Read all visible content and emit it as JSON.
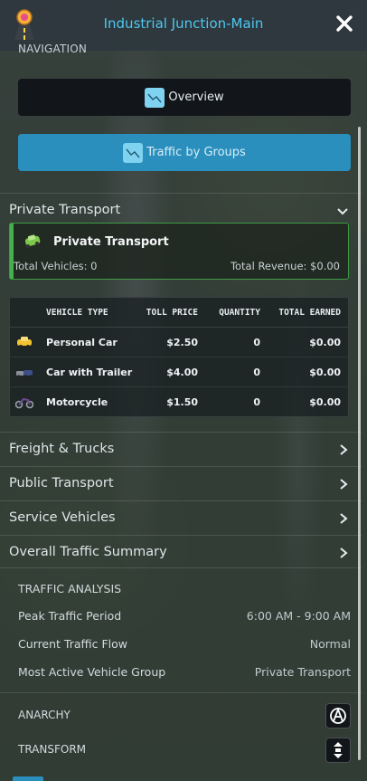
{
  "header": {
    "title": "Industrial Junction-Main",
    "logo_icon": "toll-road-icon",
    "close_icon": "close-icon"
  },
  "navigation": {
    "label": "NAVIGATION",
    "overview_label": "Overview",
    "groups_label": "Traffic by Groups"
  },
  "groups": {
    "private": {
      "label": "Private Transport",
      "expanded": true
    },
    "freight": {
      "label": "Freight & Trucks"
    },
    "public": {
      "label": "Public Transport"
    },
    "service": {
      "label": "Service Vehicles"
    },
    "summary": {
      "label": "Overall Traffic Summary"
    }
  },
  "private_card": {
    "name": "Private Transport",
    "total_vehicles": "Total Vehicles: 0",
    "total_revenue": "Total Revenue: $0.00",
    "accent": "#45b04a"
  },
  "vehicle_table": {
    "headers": [
      "VEHICLE TYPE",
      "TOLL PRICE",
      "QUANTITY",
      "TOTAL EARNED"
    ],
    "rows": [
      {
        "type": "Personal Car",
        "price": "$2.50",
        "qty": "0",
        "earned": "$0.00",
        "icon": "personal-car-icon"
      },
      {
        "type": "Car with Trailer",
        "price": "$4.00",
        "qty": "0",
        "earned": "$0.00",
        "icon": "car-trailer-icon"
      },
      {
        "type": "Motorcycle",
        "price": "$1.50",
        "qty": "0",
        "earned": "$0.00",
        "icon": "motorcycle-icon"
      }
    ]
  },
  "analysis": {
    "label": "TRAFFIC ANALYSIS",
    "items": [
      {
        "label": "Peak Traffic Period",
        "value": "6:00 AM - 9:00 AM"
      },
      {
        "label": "Current Traffic Flow",
        "value": "Normal"
      },
      {
        "label": "Most Active Vehicle Group",
        "value": "Private Transport"
      }
    ]
  },
  "tools": {
    "anarchy_label": "ANARCHY",
    "transform_label": "TRANSFORM"
  },
  "colors": {
    "accent_blue": "#4fc7ee",
    "button_blue": "#2a8fbd",
    "green": "#45b04a"
  }
}
